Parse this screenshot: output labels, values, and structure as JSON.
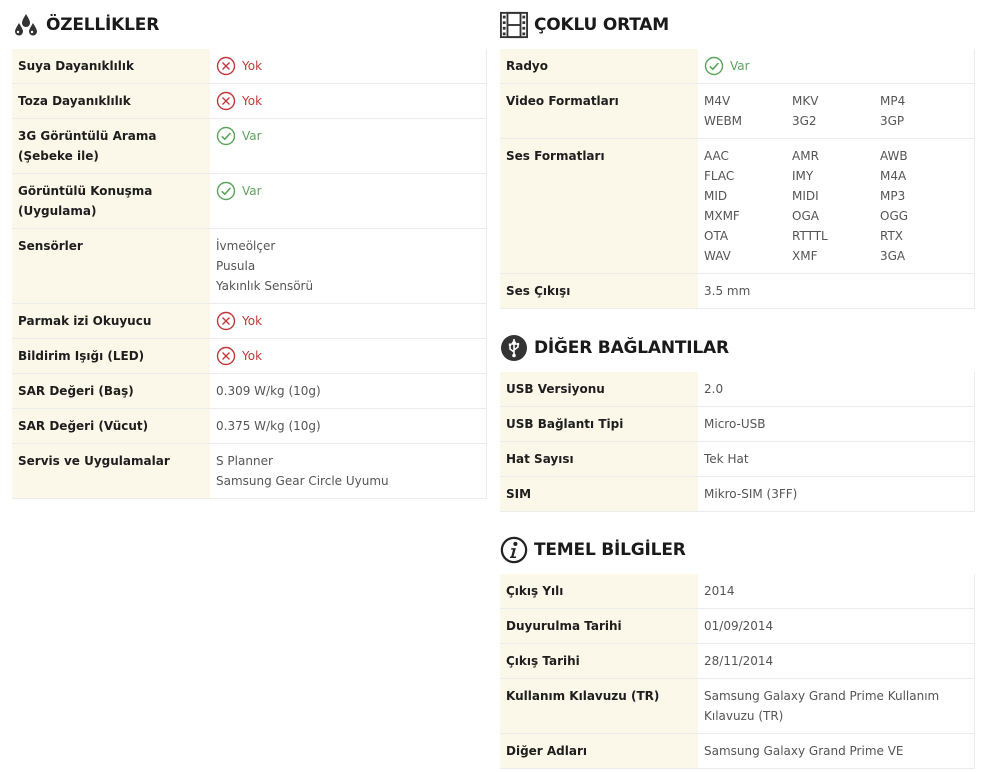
{
  "features": {
    "title": "ÖZELLİKLER",
    "icon": "water-drops-icon",
    "rows": [
      {
        "label": "Suya Dayanıklılık",
        "status": "no",
        "value": "Yok"
      },
      {
        "label": "Toza Dayanıklılık",
        "status": "no",
        "value": "Yok"
      },
      {
        "label": "3G Görüntülü Arama (Şebeke ile)",
        "status": "yes",
        "value": "Var"
      },
      {
        "label": "Görüntülü Konuşma (Uygulama)",
        "status": "yes",
        "value": "Var"
      },
      {
        "label": "Sensörler",
        "lines": [
          "İvmeölçer",
          "Pusula",
          "Yakınlık Sensörü"
        ]
      },
      {
        "label": "Parmak izi Okuyucu",
        "status": "no",
        "value": "Yok"
      },
      {
        "label": "Bildirim Işığı (LED)",
        "status": "no",
        "value": "Yok"
      },
      {
        "label": "SAR Değeri (Baş)",
        "value": "0.309 W/kg (10g)"
      },
      {
        "label": "SAR Değeri (Vücut)",
        "value": "0.375 W/kg (10g)"
      },
      {
        "label": "Servis ve Uygulamalar",
        "lines": [
          "S Planner",
          "Samsung Gear Circle Uyumu"
        ]
      }
    ]
  },
  "multimedia": {
    "title": "ÇOKLU ORTAM",
    "icon": "film-strip-icon",
    "rows": [
      {
        "label": "Radyo",
        "status": "yes",
        "value": "Var"
      },
      {
        "label": "Video Formatları",
        "grid": [
          "M4V",
          "MKV",
          "MP4",
          "WEBM",
          "3G2",
          "3GP"
        ]
      },
      {
        "label": "Ses Formatları",
        "grid": [
          "AAC",
          "AMR",
          "AWB",
          "FLAC",
          "IMY",
          "M4A",
          "MID",
          "MIDI",
          "MP3",
          "MXMF",
          "OGA",
          "OGG",
          "OTA",
          "RTTTL",
          "RTX",
          "WAV",
          "XMF",
          "3GA"
        ]
      },
      {
        "label": "Ses Çıkışı",
        "value": "3.5 mm"
      }
    ]
  },
  "connections": {
    "title": "DİĞER BAĞLANTILAR",
    "icon": "usb-icon",
    "rows": [
      {
        "label": "USB Versiyonu",
        "value": "2.0"
      },
      {
        "label": "USB Bağlantı Tipi",
        "value": "Micro-USB"
      },
      {
        "label": "Hat Sayısı",
        "value": "Tek Hat"
      },
      {
        "label": "SIM",
        "value": "Mikro-SIM (3FF)"
      }
    ]
  },
  "basics": {
    "title": "TEMEL BİLGİLER",
    "icon": "info-icon",
    "rows": [
      {
        "label": "Çıkış Yılı",
        "value": "2014"
      },
      {
        "label": "Duyurulma Tarihi",
        "value": "01/09/2014"
      },
      {
        "label": "Çıkış Tarihi",
        "value": "28/11/2014"
      },
      {
        "label": "Kullanım Kılavuzu (TR)",
        "value": "Samsung Galaxy Grand Prime Kullanım Kılavuzu (TR)"
      },
      {
        "label": "Diğer Adları",
        "value": "Samsung Galaxy Grand Prime VE"
      }
    ]
  },
  "colors": {
    "label_bg": "#fbf7e9",
    "no": "#c0393b",
    "yes": "#5aa55a"
  }
}
